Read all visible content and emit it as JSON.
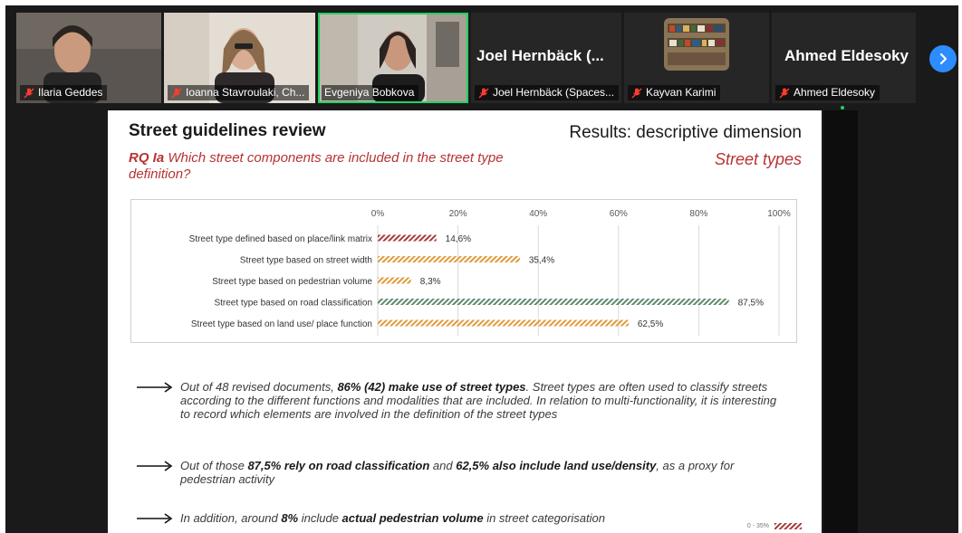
{
  "participants": [
    {
      "name": "Ilaria Geddes",
      "muted": true
    },
    {
      "name": "Ioanna Stavroulaki, Ch...",
      "muted": true
    },
    {
      "name": "Evgeniya Bobkova",
      "muted": false,
      "active": true
    },
    {
      "name": "Joel Hernbäck (Spaces...",
      "display": "Joel  Hernbäck (...",
      "muted": true
    },
    {
      "name": "Kayvan Karimi",
      "muted": true
    },
    {
      "name": "Ahmed Eldesoky",
      "display": "Ahmed Eldesoky",
      "muted": true
    }
  ],
  "colors": {
    "accent_red": "#b83232",
    "active_border": "#23d160",
    "nav_button": "#2d8cff",
    "bar_red": "#a63a3a",
    "bar_orange": "#e29a3a",
    "bar_green": "#5d8a6a"
  },
  "slide": {
    "title": "Street guidelines review",
    "rq_label": "RQ Ia",
    "rq_text": "Which street components are included in the street type definition?",
    "results_title": "Results: descriptive dimension",
    "section": "Street types",
    "bullets": [
      {
        "parts": [
          {
            "t": "Out of 48 revised documents, "
          },
          {
            "t": "86% (42) make use of street types",
            "b": true
          },
          {
            "t": ". Street types are often used to classify streets according to the different functions and modalities that are included. In relation to multi-functionality, it is interesting to record which elements are involved in the definition of the street types"
          }
        ]
      },
      {
        "parts": [
          {
            "t": "Out of those "
          },
          {
            "t": "87,5% rely on road classification",
            "b": true
          },
          {
            "t": " and "
          },
          {
            "t": "62,5% also include land use/density",
            "b": true
          },
          {
            "t": ", as a proxy for pedestrian activity"
          }
        ]
      },
      {
        "parts": [
          {
            "t": "In addition, around  "
          },
          {
            "t": "8%",
            "b": true
          },
          {
            "t": " include "
          },
          {
            "t": "actual pedestrian volume",
            "b": true
          },
          {
            "t": " in street categorisation"
          }
        ]
      }
    ],
    "legend_mini": "0 - 35%"
  },
  "chart_data": {
    "type": "bar",
    "orientation": "horizontal",
    "categories": [
      "Street type defined based on place/link matrix",
      "Street type based on street width",
      "Street type based on pedestrian volume",
      "Street type  based on road classification",
      "Street type  based on land use/ place function"
    ],
    "values": [
      14.6,
      35.4,
      8.3,
      87.5,
      62.5
    ],
    "value_labels": [
      "14,6%",
      "35,4%",
      "8,3%",
      "87,5%",
      "62,5%"
    ],
    "bar_colors": [
      "#a63a3a",
      "#e29a3a",
      "#e29a3a",
      "#5d8a6a",
      "#e29a3a"
    ],
    "xlim": [
      0,
      100
    ],
    "xticks": [
      "0%",
      "20%",
      "40%",
      "60%",
      "80%",
      "100%"
    ],
    "grid": true
  }
}
